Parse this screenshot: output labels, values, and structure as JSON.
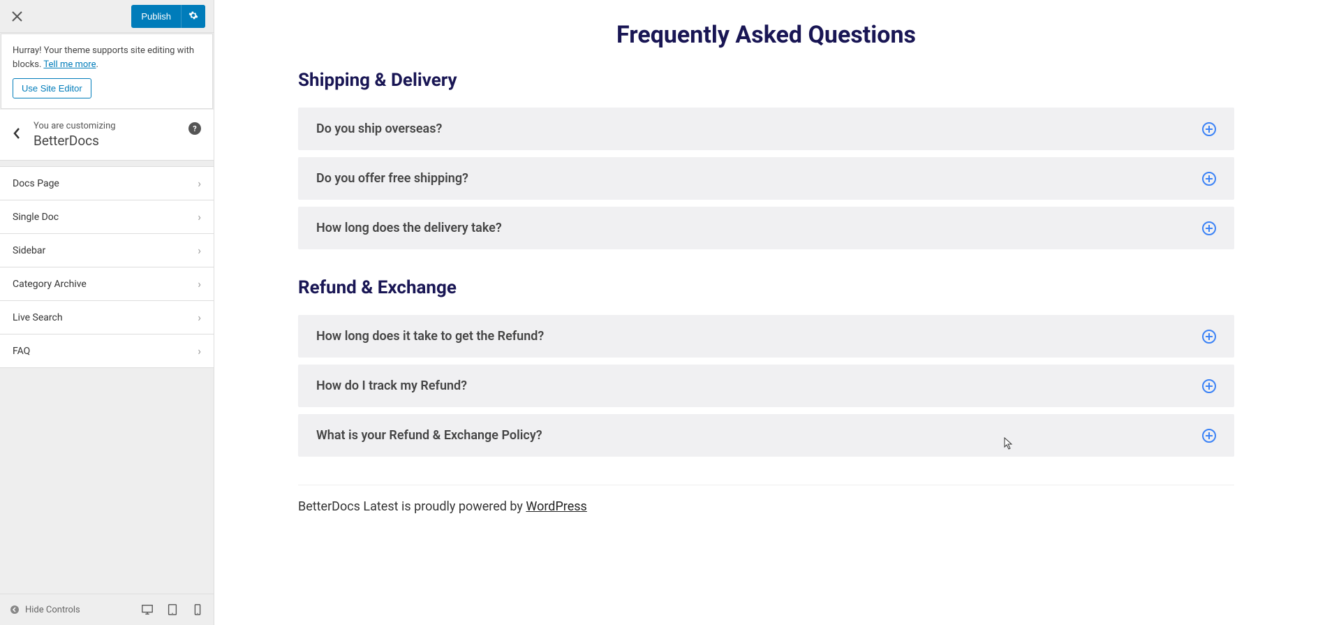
{
  "topbar": {
    "publish_label": "Publish"
  },
  "notice": {
    "text_prefix": "Hurray! Your theme supports site editing with blocks. ",
    "link_text": "Tell me more",
    "text_suffix": ".",
    "button_label": "Use Site Editor"
  },
  "header": {
    "customizing_label": "You are customizing",
    "title": "BetterDocs"
  },
  "menu": {
    "items": [
      {
        "label": "Docs Page"
      },
      {
        "label": "Single Doc"
      },
      {
        "label": "Sidebar"
      },
      {
        "label": "Category Archive"
      },
      {
        "label": "Live Search"
      },
      {
        "label": "FAQ"
      }
    ]
  },
  "bottombar": {
    "hide_controls_label": "Hide Controls"
  },
  "faq": {
    "title": "Frequently Asked Questions",
    "sections": [
      {
        "title": "Shipping & Delivery",
        "items": [
          {
            "question": "Do you ship overseas?"
          },
          {
            "question": "Do you offer free shipping?"
          },
          {
            "question": "How long does the delivery take?"
          }
        ]
      },
      {
        "title": "Refund & Exchange",
        "items": [
          {
            "question": "How long does it take to get the Refund?"
          },
          {
            "question": "How do I track my Refund?"
          },
          {
            "question": "What is your Refund & Exchange Policy?"
          }
        ]
      }
    ]
  },
  "footer": {
    "text_prefix": "BetterDocs Latest is proudly powered by ",
    "link_text": "WordPress"
  }
}
